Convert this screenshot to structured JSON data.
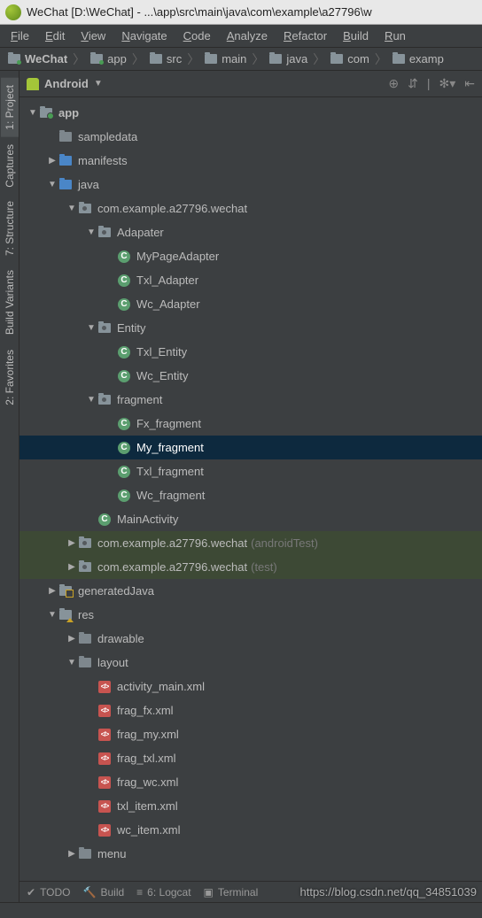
{
  "title": "WeChat [D:\\WeChat] - ...\\app\\src\\main\\java\\com\\example\\a27796\\w",
  "menu": [
    "File",
    "Edit",
    "View",
    "Navigate",
    "Code",
    "Analyze",
    "Refactor",
    "Build",
    "Run"
  ],
  "breadcrumbs": [
    {
      "label": "WeChat",
      "icon": "module"
    },
    {
      "label": "app",
      "icon": "module"
    },
    {
      "label": "src",
      "icon": "folder"
    },
    {
      "label": "main",
      "icon": "folder"
    },
    {
      "label": "java",
      "icon": "folder"
    },
    {
      "label": "com",
      "icon": "folder"
    },
    {
      "label": "examp",
      "icon": "folder"
    }
  ],
  "panel": {
    "selector": "Android"
  },
  "left_tools": [
    {
      "label": "1: Project",
      "active": true
    },
    {
      "label": "Captures",
      "active": false
    },
    {
      "label": "7: Structure",
      "active": false
    },
    {
      "label": "Build Variants",
      "active": false
    },
    {
      "label": "2: Favorites",
      "active": false
    }
  ],
  "tree": [
    {
      "d": 0,
      "a": "down",
      "i": "module",
      "t": "app"
    },
    {
      "d": 1,
      "a": "",
      "i": "folder-grey",
      "t": "sampledata"
    },
    {
      "d": 1,
      "a": "right",
      "i": "folder-blue",
      "t": "manifests"
    },
    {
      "d": 1,
      "a": "down",
      "i": "folder-blue",
      "t": "java"
    },
    {
      "d": 2,
      "a": "down",
      "i": "pkg",
      "t": "com.example.a27796.wechat"
    },
    {
      "d": 3,
      "a": "down",
      "i": "pkg",
      "t": "Adapater"
    },
    {
      "d": 4,
      "a": "",
      "i": "class",
      "t": "MyPageAdapter"
    },
    {
      "d": 4,
      "a": "",
      "i": "class",
      "t": "Txl_Adapter"
    },
    {
      "d": 4,
      "a": "",
      "i": "class",
      "t": "Wc_Adapter"
    },
    {
      "d": 3,
      "a": "down",
      "i": "pkg",
      "t": "Entity"
    },
    {
      "d": 4,
      "a": "",
      "i": "class",
      "t": "Txl_Entity"
    },
    {
      "d": 4,
      "a": "",
      "i": "class",
      "t": "Wc_Entity"
    },
    {
      "d": 3,
      "a": "down",
      "i": "pkg",
      "t": "fragment"
    },
    {
      "d": 4,
      "a": "",
      "i": "class",
      "t": "Fx_fragment"
    },
    {
      "d": 4,
      "a": "",
      "i": "class",
      "t": "My_fragment",
      "sel": true
    },
    {
      "d": 4,
      "a": "",
      "i": "class",
      "t": "Txl_fragment"
    },
    {
      "d": 4,
      "a": "",
      "i": "class",
      "t": "Wc_fragment"
    },
    {
      "d": 3,
      "a": "",
      "i": "class",
      "t": "MainActivity"
    },
    {
      "d": 2,
      "a": "right",
      "i": "pkg",
      "t": "com.example.a27796.wechat",
      "s": "(androidTest)",
      "hl": true
    },
    {
      "d": 2,
      "a": "right",
      "i": "pkg",
      "t": "com.example.a27796.wechat",
      "s": "(test)",
      "hl": true
    },
    {
      "d": 1,
      "a": "right",
      "i": "gen",
      "t": "generatedJava"
    },
    {
      "d": 1,
      "a": "down",
      "i": "res",
      "t": "res"
    },
    {
      "d": 2,
      "a": "right",
      "i": "folder-grey",
      "t": "drawable"
    },
    {
      "d": 2,
      "a": "down",
      "i": "folder-grey",
      "t": "layout"
    },
    {
      "d": 3,
      "a": "",
      "i": "xml",
      "t": "activity_main.xml"
    },
    {
      "d": 3,
      "a": "",
      "i": "xml",
      "t": "frag_fx.xml"
    },
    {
      "d": 3,
      "a": "",
      "i": "xml",
      "t": "frag_my.xml"
    },
    {
      "d": 3,
      "a": "",
      "i": "xml",
      "t": "frag_txl.xml"
    },
    {
      "d": 3,
      "a": "",
      "i": "xml",
      "t": "frag_wc.xml"
    },
    {
      "d": 3,
      "a": "",
      "i": "xml",
      "t": "txl_item.xml"
    },
    {
      "d": 3,
      "a": "",
      "i": "xml",
      "t": "wc_item.xml"
    },
    {
      "d": 2,
      "a": "right",
      "i": "folder-grey",
      "t": "menu"
    }
  ],
  "bottom_tabs": [
    "TODO",
    "Build",
    "6: Logcat",
    "Terminal"
  ],
  "watermark": "https://blog.csdn.net/qq_34851039"
}
